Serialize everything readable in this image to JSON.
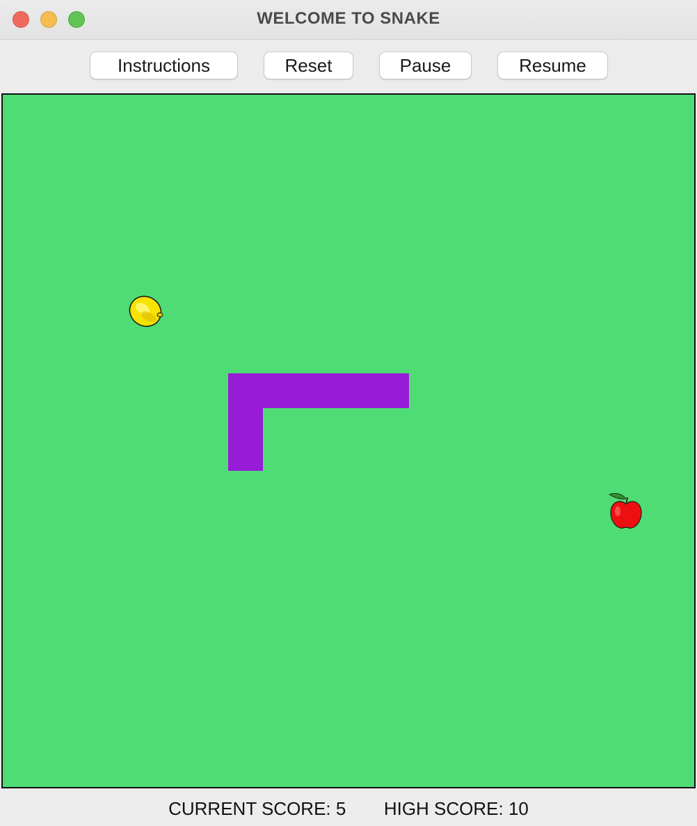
{
  "window": {
    "title": "WELCOME TO SNAKE"
  },
  "toolbar": {
    "instructions_label": "Instructions",
    "reset_label": "Reset",
    "pause_label": "Pause",
    "resume_label": "Resume"
  },
  "game": {
    "board_color": "#50dc75",
    "snake_color": "#971cd8",
    "fruits": [
      "lemon",
      "apple"
    ]
  },
  "status": {
    "current_score_label": "CURRENT SCORE:",
    "current_score": "5",
    "high_score_label": "HIGH SCORE:",
    "high_score": "10"
  },
  "icons": [
    "close-icon",
    "minimize-icon",
    "maximize-icon",
    "lemon-icon",
    "apple-icon"
  ]
}
